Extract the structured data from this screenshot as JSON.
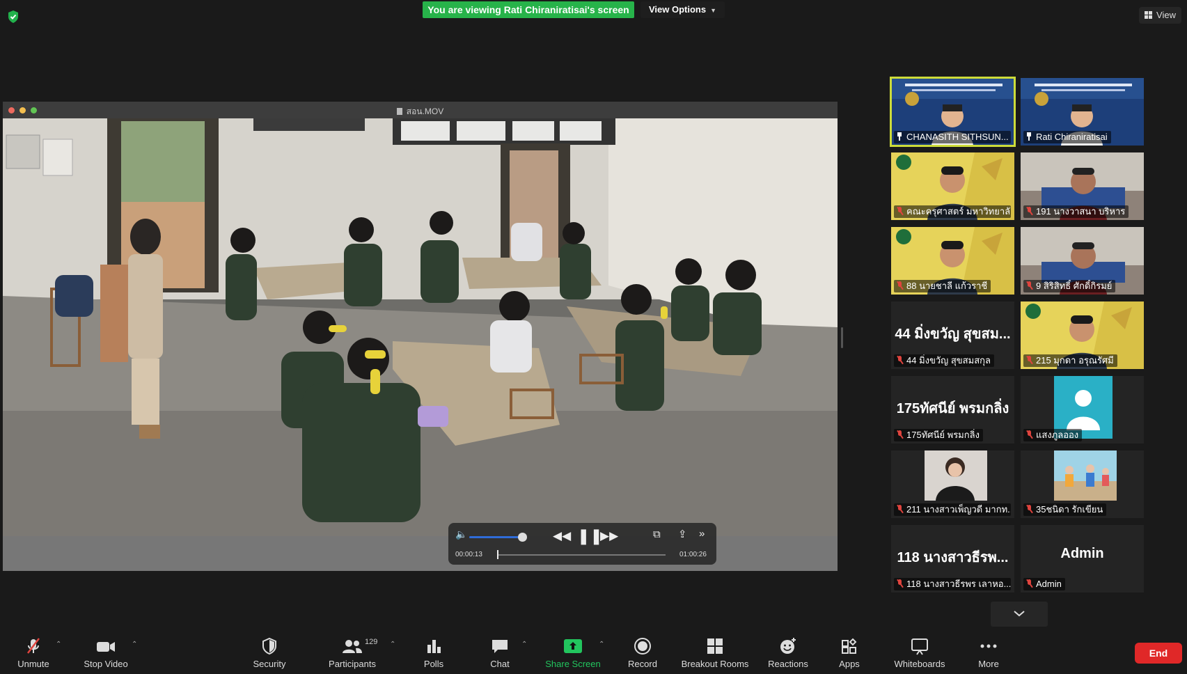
{
  "top_bar": {
    "banner": "You are viewing Rati Chiraniratisai's screen",
    "view_options": "View Options",
    "view": "View"
  },
  "shared_window": {
    "title": "สอน.MOV",
    "player": {
      "elapsed": "00:00:13",
      "duration": "01:00:26",
      "progress": 0.004,
      "volume": 0.6
    }
  },
  "gallery": [
    {
      "name": "CHANASITH SITHSUN...",
      "pinned": true,
      "muted": false,
      "active": true,
      "video": "stage-blue"
    },
    {
      "name": "Rati Chiraniratisai",
      "pinned": true,
      "muted": false,
      "active": false,
      "video": "stage-blue"
    },
    {
      "name": "คณะครุศาสตร์ มหาวิทยาลั...",
      "pinned": false,
      "muted": true,
      "active": false,
      "video": "yellow-bg"
    },
    {
      "name": "191 นางวาสนา บริหาร",
      "pinned": false,
      "muted": true,
      "active": false,
      "video": "room"
    },
    {
      "name": "88 นายชาลี แก้วราชี",
      "pinned": false,
      "muted": true,
      "active": false,
      "video": "yellow-bg"
    },
    {
      "name": "9 สิริสิทธิ์ ศักดิ์กิรมย์",
      "pinned": false,
      "muted": true,
      "active": false,
      "video": "room"
    },
    {
      "name": "44 มิ่งขวัญ สุขสมสกุล",
      "big": "44 มิ่งขวัญ สุขสม...",
      "pinned": false,
      "muted": true,
      "active": false,
      "video": "none"
    },
    {
      "name": "215 มุกดา อรุณรัศมี",
      "pinned": false,
      "muted": true,
      "active": false,
      "video": "yellow-bg"
    },
    {
      "name": "175ทัศนีย์ พรมกลิ่ง",
      "big": "175ทัศนีย์ พรมกลิ่ง",
      "pinned": false,
      "muted": true,
      "active": false,
      "video": "none"
    },
    {
      "name": "แสงภูลออง",
      "pinned": false,
      "muted": true,
      "active": false,
      "video": "avatar"
    },
    {
      "name": "211 นางสาวเพ็ญวดี มากท...",
      "pinned": false,
      "muted": true,
      "active": false,
      "video": "photo"
    },
    {
      "name": "35ชนิดา รักเขียน",
      "pinned": false,
      "muted": true,
      "active": false,
      "video": "kids"
    },
    {
      "name": "118 นางสาวธีรพร เลาหอ...",
      "big": "118 นางสาวธีรพ...",
      "pinned": false,
      "muted": true,
      "active": false,
      "video": "none"
    },
    {
      "name": "Admin",
      "big": "Admin",
      "pinned": false,
      "muted": true,
      "active": false,
      "video": "none"
    }
  ],
  "toolbar": {
    "unmute": "Unmute",
    "stop_video": "Stop Video",
    "security": "Security",
    "participants": "Participants",
    "participants_count": "129",
    "polls": "Polls",
    "chat": "Chat",
    "share_screen": "Share Screen",
    "record": "Record",
    "breakout_rooms": "Breakout Rooms",
    "reactions": "Reactions",
    "apps": "Apps",
    "whiteboards": "Whiteboards",
    "more": "More",
    "end": "End"
  },
  "colors": {
    "banner_green": "#27b34a",
    "share_green": "#22c55e",
    "active_speaker": "#cddc39",
    "end_red": "#e02828",
    "muted_red": "#e0443e"
  }
}
